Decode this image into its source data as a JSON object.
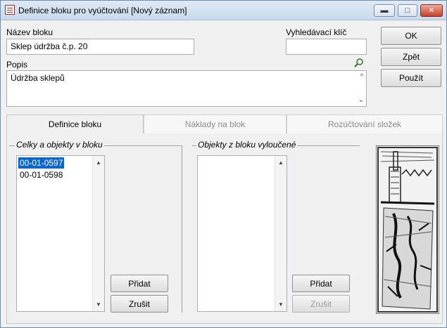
{
  "window": {
    "title": "Definice bloku pro vyúčtování [Nový záznam]",
    "minimize_glyph": "▬",
    "maximize_glyph": "□",
    "close_glyph": "✕"
  },
  "form": {
    "nazev_label": "Název bloku",
    "nazev_value": "Sklep údržba č.p. 20",
    "klic_label": "Vyhledávací klíč",
    "klic_value": "",
    "popis_label": "Popis",
    "popis_value": "Údržba sklepů"
  },
  "actions": {
    "ok": "OK",
    "back": "Zpět",
    "apply": "Použít"
  },
  "tabs": [
    {
      "label": "Definice bloku",
      "active": true
    },
    {
      "label": "Náklady na blok",
      "active": false
    },
    {
      "label": "Rozúčtování složek",
      "active": false
    }
  ],
  "included": {
    "title": "Celky a objekty v bloku",
    "items": [
      "00-01-0597",
      "00-01-0598"
    ],
    "selected": "00-01-0597",
    "add": "Přidat",
    "cancel": "Zrušit"
  },
  "excluded": {
    "title": "Objekty z bloku vyloučené",
    "items": [],
    "add": "Přidat",
    "cancel": "Zrušit"
  },
  "icons": {
    "app": "form-icon",
    "popis_tool": "magnifier-icon",
    "illustration": "sketch-illustration"
  },
  "colors": {
    "selection": "#0b66d0",
    "close": "#c8412a"
  }
}
